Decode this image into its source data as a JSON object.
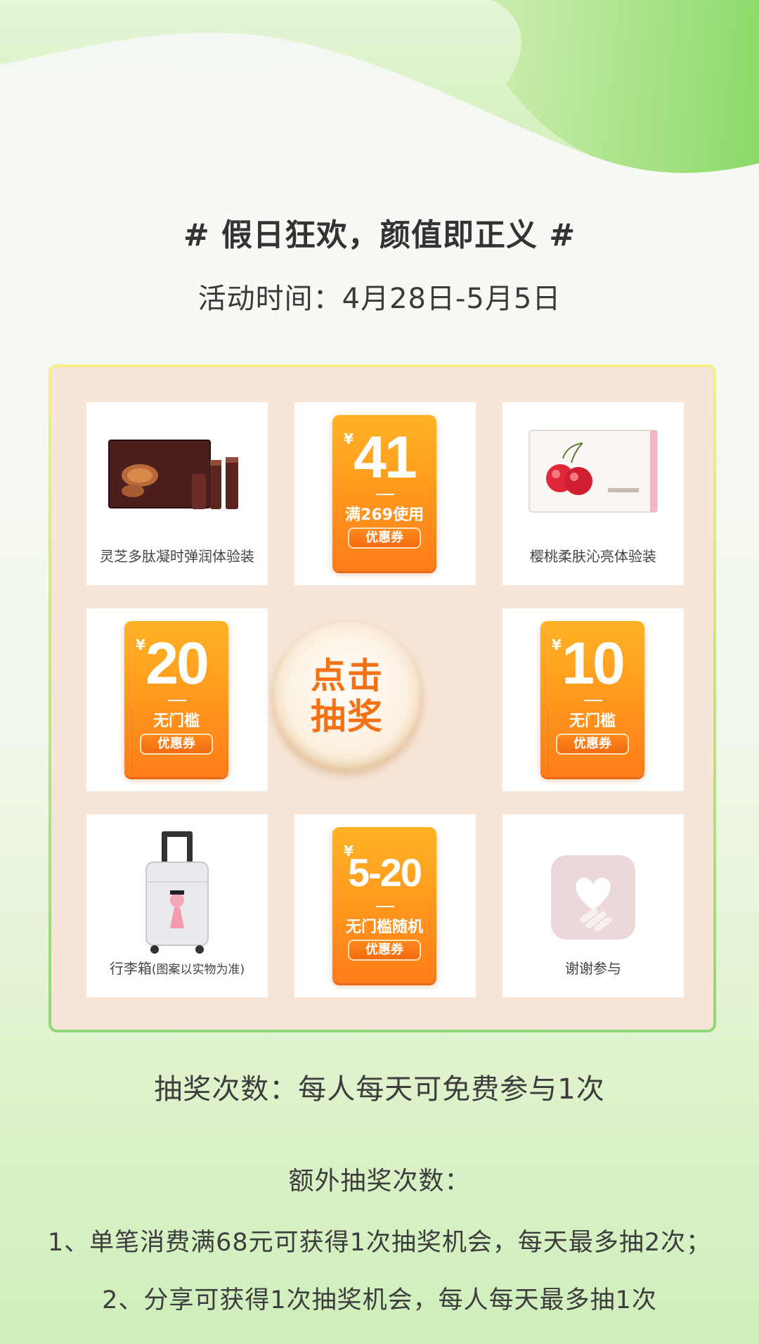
{
  "header": {
    "title": "# 假日狂欢，颜值即正义 #",
    "date": "活动时间：4月28日-5月5日"
  },
  "colors": {
    "accent_green": "#8fd77a",
    "coupon_orange": "#ff8c1c",
    "button_text": "#f47116",
    "board_bg": "#f7e6d8"
  },
  "prizes": {
    "p1": {
      "label": "灵芝多肽凝时弹润体验装",
      "icon": "lingzhi-gift-box-icon"
    },
    "p2": {
      "yen": "¥",
      "amount": "41",
      "condition": "满269使用",
      "tag": "优惠券"
    },
    "p3": {
      "label": "樱桃柔肤沁亮体验装",
      "icon": "cherry-gift-box-icon"
    },
    "p4": {
      "yen": "¥",
      "amount": "20",
      "condition": "无门槛",
      "tag": "优惠券"
    },
    "p6": {
      "yen": "¥",
      "amount": "10",
      "condition": "无门槛",
      "tag": "优惠券"
    },
    "p7": {
      "label": "行李箱",
      "label_note": "(图案以实物为准)",
      "icon": "luggage-icon"
    },
    "p8": {
      "yen": "¥",
      "amount": "5-20",
      "condition": "无门槛随机",
      "tag": "优惠券"
    },
    "p9": {
      "label": "谢谢参与",
      "icon": "heart-hand-icon"
    }
  },
  "draw_button": {
    "line1": "点击",
    "line2": "抽奖"
  },
  "rules": {
    "main": "抽奖次数：每人每天可免费参与1次",
    "extra_title": "额外抽奖次数：",
    "items": [
      "1、单笔消费满68元可获得1次抽奖机会，每天最多抽2次；",
      "2、分享可获得1次抽奖机会，每人每天最多抽1次"
    ]
  }
}
